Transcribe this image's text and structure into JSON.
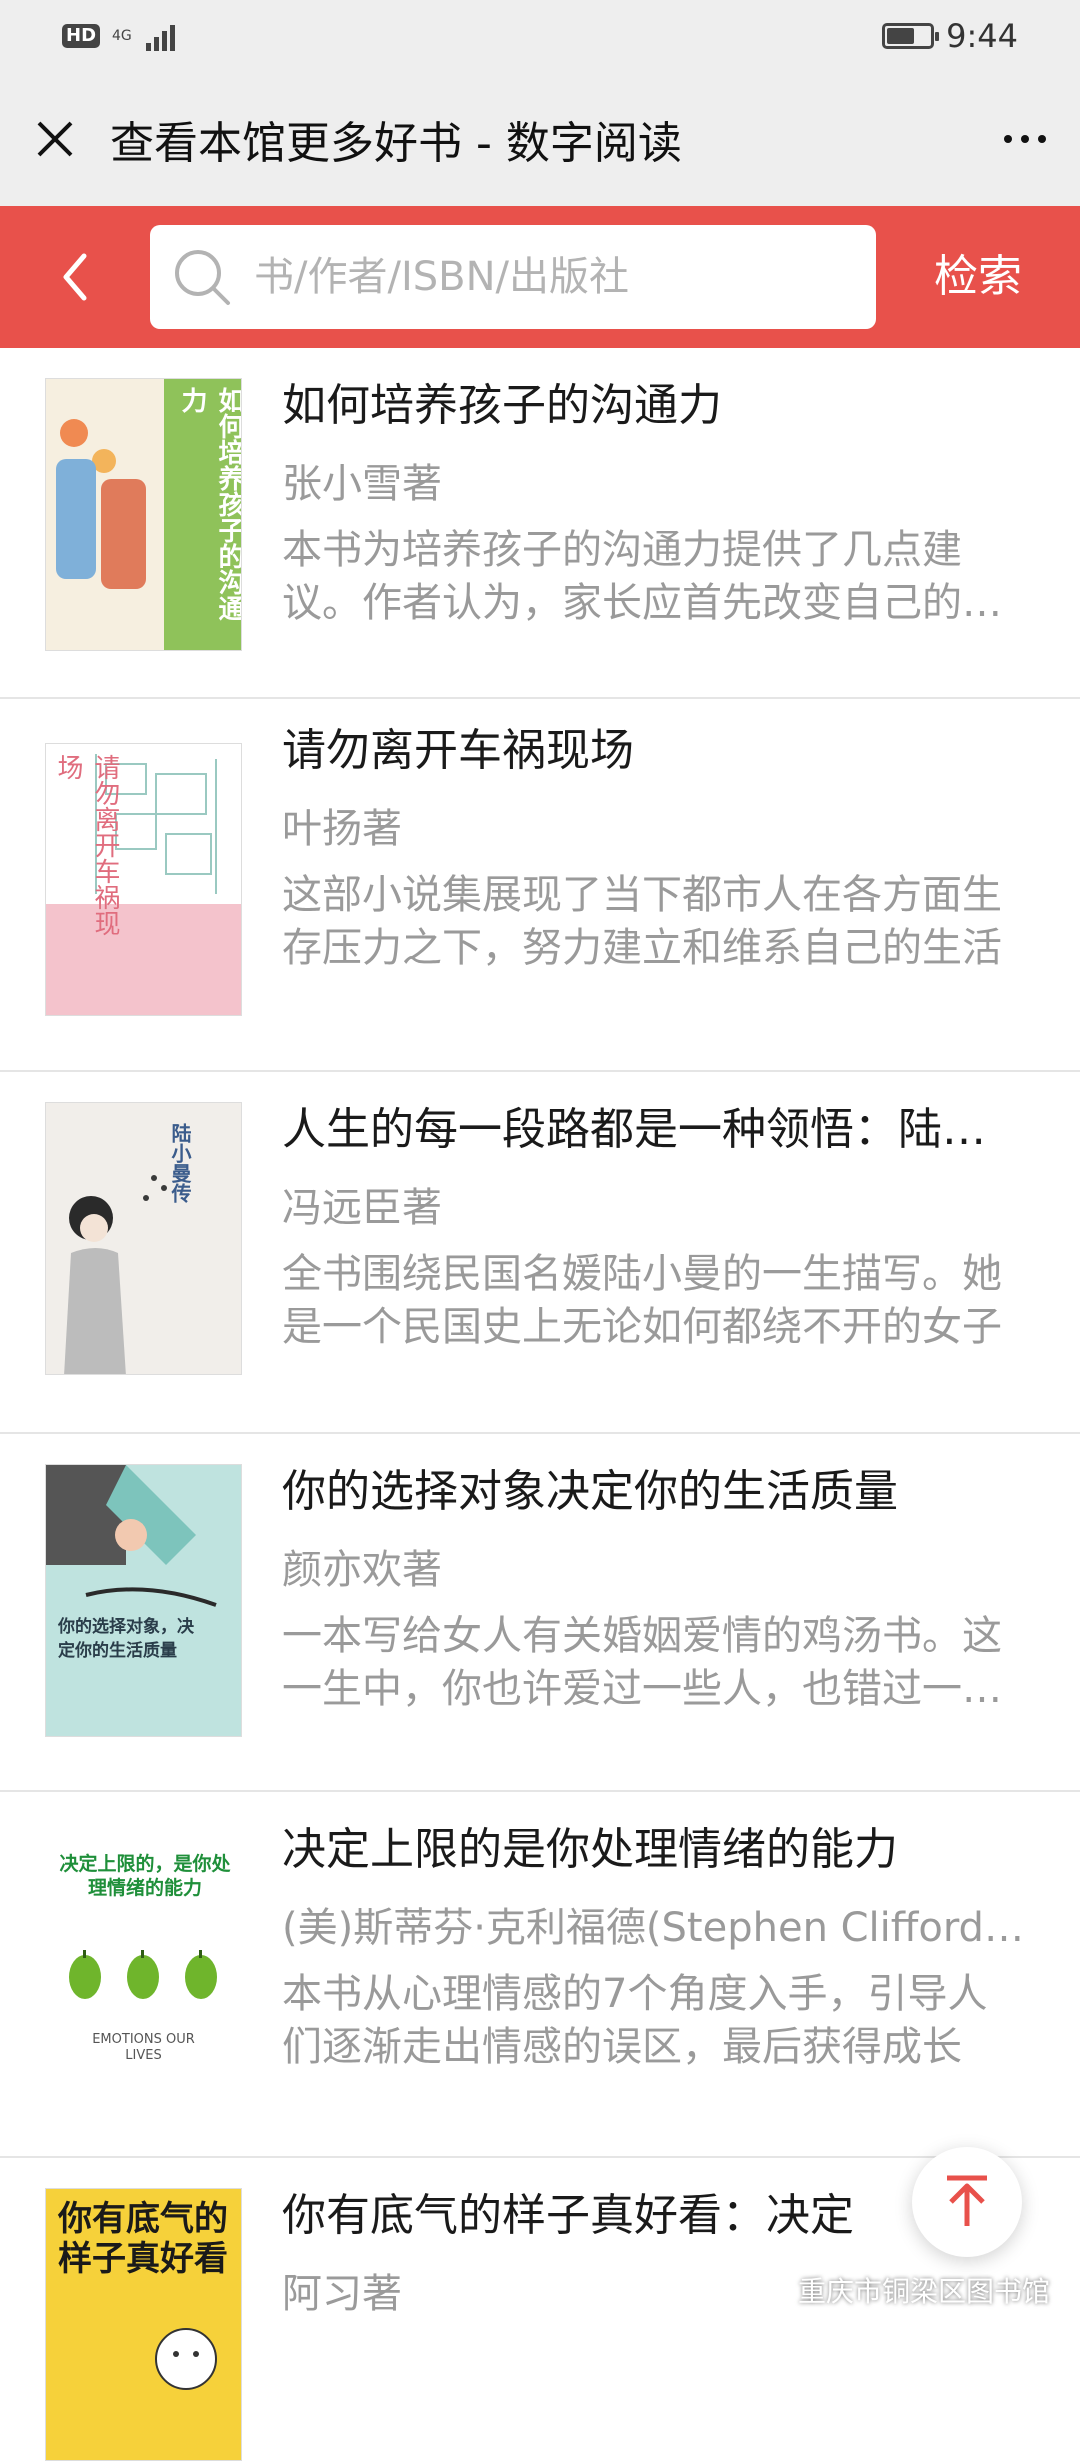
{
  "status_bar": {
    "hd": "HD",
    "network": "4G",
    "time": "9:44",
    "battery_level": 0.65
  },
  "title_bar": {
    "title": "查看本馆更多好书 - 数字阅读"
  },
  "search": {
    "placeholder": "书/作者/ISBN/出版社",
    "submit_label": "检索"
  },
  "books": [
    {
      "title": "如何培养孩子的沟通力",
      "author": "张小雪著",
      "description": "本书为培养孩子的沟通力提供了几点建议。作者认为，家长应首先改变自己的观念",
      "cover_text": "如何培养孩子的沟通力",
      "cover_color": "#8fc25a"
    },
    {
      "title": "请勿离开车祸现场",
      "author": "叶扬著",
      "description": "这部小说集展现了当下都市人在各方面生存压力之下，努力建立和维系自己的生活",
      "cover_text": "请勿离开车祸现场",
      "cover_color": "#f4c3cc"
    },
    {
      "title": "人生的每一段路都是一种领悟：陆小曼传",
      "author": "冯远臣著",
      "description": "全书围绕民国名媛陆小曼的一生描写。她是一个民国史上无论如何都绕不开的女子",
      "cover_text": "陆小曼传",
      "cover_color": "#f1eeea"
    },
    {
      "title": "你的选择对象决定你的生活质量",
      "author": "颜亦欢著",
      "description": "一本写给女人有关婚姻爱情的鸡汤书。这一生中，你也许爱过一些人，也错过一些人",
      "cover_text": "你的选择对象，决定你的生活质量",
      "cover_color": "#bfe3df"
    },
    {
      "title": "决定上限的是你处理情绪的能力",
      "author": "(美)斯蒂芬·克利福德(Stephen Clifford)著",
      "description": "本书从心理情感的7个角度入手，引导人们逐渐走出情感的误区，最后获得成长",
      "cover_text": "决定上限的，是你处理情绪的能力",
      "cover_sub": "EMOTIONS OUR LIVES",
      "cover_color": "#ffffff"
    },
    {
      "title": "你有底气的样子真好看：决定",
      "author": "阿习著",
      "description": "",
      "cover_text": "你有底气的样子真好看",
      "cover_color": "#f6d13a"
    }
  ],
  "watermark": "重庆市铜梁区图书馆",
  "colors": {
    "accent": "#e8514b",
    "title_bar": "#eeeeee"
  }
}
